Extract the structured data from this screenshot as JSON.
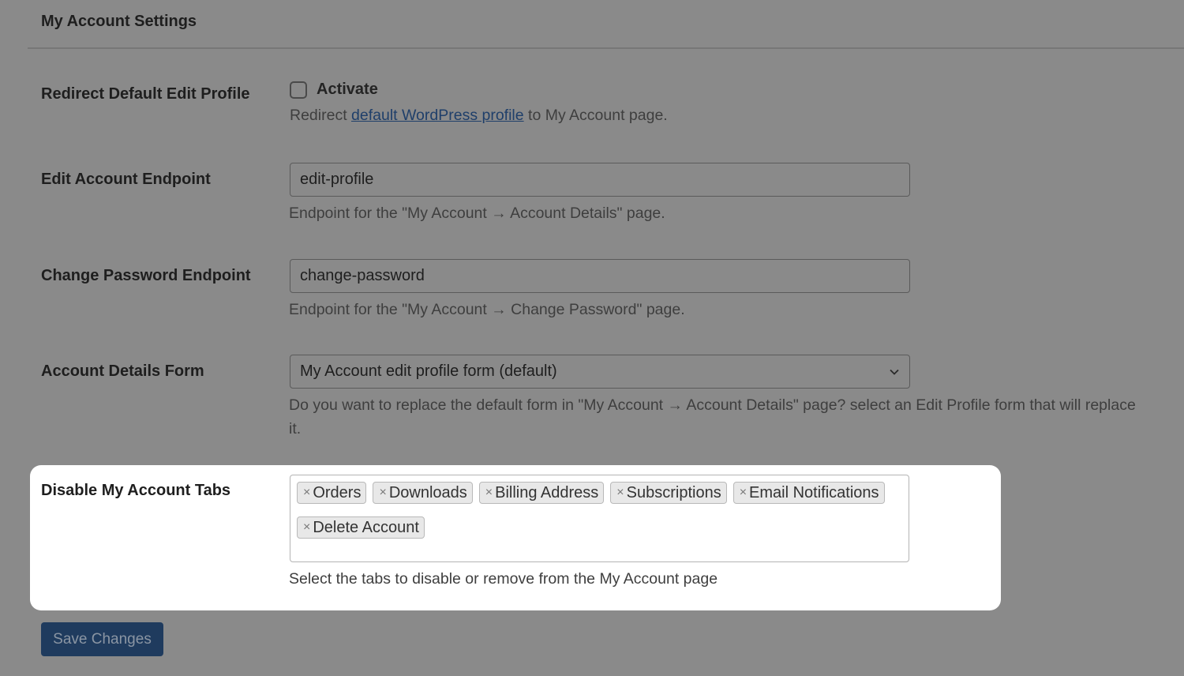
{
  "section": {
    "title": "My Account Settings"
  },
  "rows": {
    "redirect": {
      "label": "Redirect Default Edit Profile",
      "checkbox_label": "Activate",
      "checked": false,
      "desc_before": "Redirect ",
      "desc_link": "default WordPress profile",
      "desc_after": " to My Account page."
    },
    "edit_endpoint": {
      "label": "Edit Account Endpoint",
      "value": "edit-profile",
      "desc": "Endpoint for the \"My Account → Account Details\" page."
    },
    "password_endpoint": {
      "label": "Change Password Endpoint",
      "value": "change-password",
      "desc": "Endpoint for the \"My Account → Change Password\" page."
    },
    "details_form": {
      "label": "Account Details Form",
      "selected": "My Account edit profile form (default)",
      "desc": "Do you want to replace the default form in \"My Account → Account Details\" page? select an Edit Profile form that will replace it."
    },
    "disable_tabs": {
      "label": "Disable My Account Tabs",
      "remove_glyph": "×",
      "chips": [
        "Orders",
        "Downloads",
        "Billing Address",
        "Subscriptions",
        "Email Notifications",
        "Delete Account"
      ],
      "desc": "Select the tabs to disable or remove from the My Account page"
    }
  },
  "footer": {
    "save_label": "Save Changes"
  },
  "colors": {
    "overlay_bg": "#8a8a8a",
    "spotlight_bg": "#ffffff",
    "primary_button": "#1f3b5e",
    "link": "#1f3f6a"
  }
}
